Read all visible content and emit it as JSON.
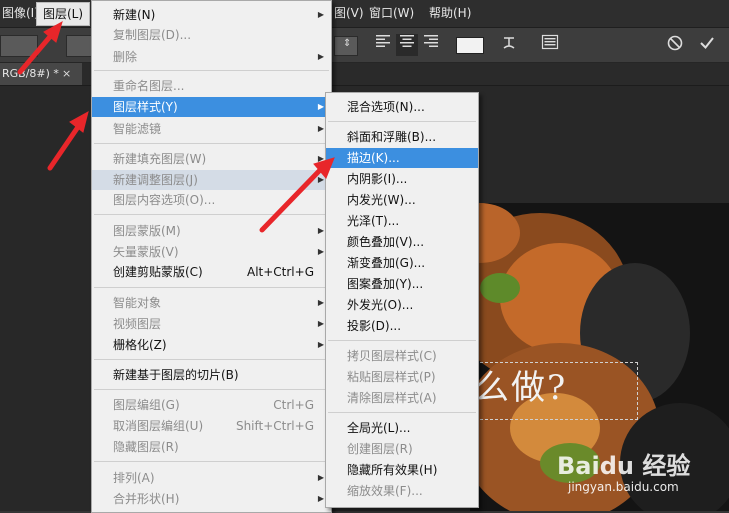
{
  "menubar": {
    "items": [
      "图像(I)",
      "图层(L)",
      "图(V)",
      "窗口(W)",
      "帮助(H)"
    ]
  },
  "doc_tab": {
    "title": "RGB/8#) *",
    "close": "×"
  },
  "main_menu": {
    "items": [
      {
        "label": "新建(N)",
        "sub": true
      },
      {
        "label": "复制图层(D)...",
        "disabled": true
      },
      {
        "label": "删除",
        "disabled": true,
        "sub": true
      },
      {
        "label": "重命名图层...",
        "disabled": true
      },
      {
        "label": "图层样式(Y)",
        "sub": true,
        "highlighted": true
      },
      {
        "label": "智能滤镜",
        "disabled": true,
        "sub": true
      },
      {
        "label": "新建填充图层(W)",
        "disabled": true,
        "sub": true
      },
      {
        "label": "新建调整图层(J)",
        "disabled": true,
        "sub": true
      },
      {
        "label": "图层内容选项(O)...",
        "disabled": true
      },
      {
        "label": "图层蒙版(M)",
        "disabled": true,
        "sub": true
      },
      {
        "label": "矢量蒙版(V)",
        "disabled": true,
        "sub": true
      },
      {
        "label": "创建剪贴蒙版(C)",
        "shortcut": "Alt+Ctrl+G"
      },
      {
        "label": "智能对象",
        "disabled": true,
        "sub": true
      },
      {
        "label": "视频图层",
        "disabled": true,
        "sub": true
      },
      {
        "label": "栅格化(Z)",
        "sub": true
      },
      {
        "label": "新建基于图层的切片(B)"
      },
      {
        "label": "图层编组(G)",
        "disabled": true,
        "shortcut": "Ctrl+G"
      },
      {
        "label": "取消图层编组(U)",
        "disabled": true,
        "shortcut": "Shift+Ctrl+G"
      },
      {
        "label": "隐藏图层(R)",
        "disabled": true
      },
      {
        "label": "排列(A)",
        "disabled": true,
        "sub": true
      },
      {
        "label": "合并形状(H)",
        "disabled": true,
        "sub": true
      }
    ]
  },
  "sub_menu": {
    "items": [
      {
        "label": "混合选项(N)..."
      },
      {
        "label": "斜面和浮雕(B)..."
      },
      {
        "label": "描边(K)...",
        "highlighted": true
      },
      {
        "label": "内阴影(I)..."
      },
      {
        "label": "内发光(W)..."
      },
      {
        "label": "光泽(T)..."
      },
      {
        "label": "颜色叠加(V)..."
      },
      {
        "label": "渐变叠加(G)..."
      },
      {
        "label": "图案叠加(Y)..."
      },
      {
        "label": "外发光(O)..."
      },
      {
        "label": "投影(D)..."
      },
      {
        "label": "拷贝图层样式(C)",
        "disabled": true
      },
      {
        "label": "粘贴图层样式(P)",
        "disabled": true
      },
      {
        "label": "清除图层样式(A)",
        "disabled": true
      },
      {
        "label": "全局光(L)..."
      },
      {
        "label": "创建图层(R)",
        "disabled": true
      },
      {
        "label": "隐藏所有效果(H)"
      },
      {
        "label": "缩放效果(F)...",
        "disabled": true
      }
    ]
  },
  "photo": {
    "text": "么做?",
    "watermark": "Baidu 经验",
    "watermark_url": "jingyan.baidu.com"
  },
  "icons": [
    "cancel-icon",
    "commit-check-icon",
    "align-left-icon",
    "align-center-icon",
    "align-right-icon",
    "warp-text-icon",
    "character-panel-icon",
    "dropdown-icon"
  ],
  "colors": {
    "highlight": "#3c8fe0",
    "arrow": "#e8262a",
    "text_color_swatch": "#f2f2f2"
  }
}
